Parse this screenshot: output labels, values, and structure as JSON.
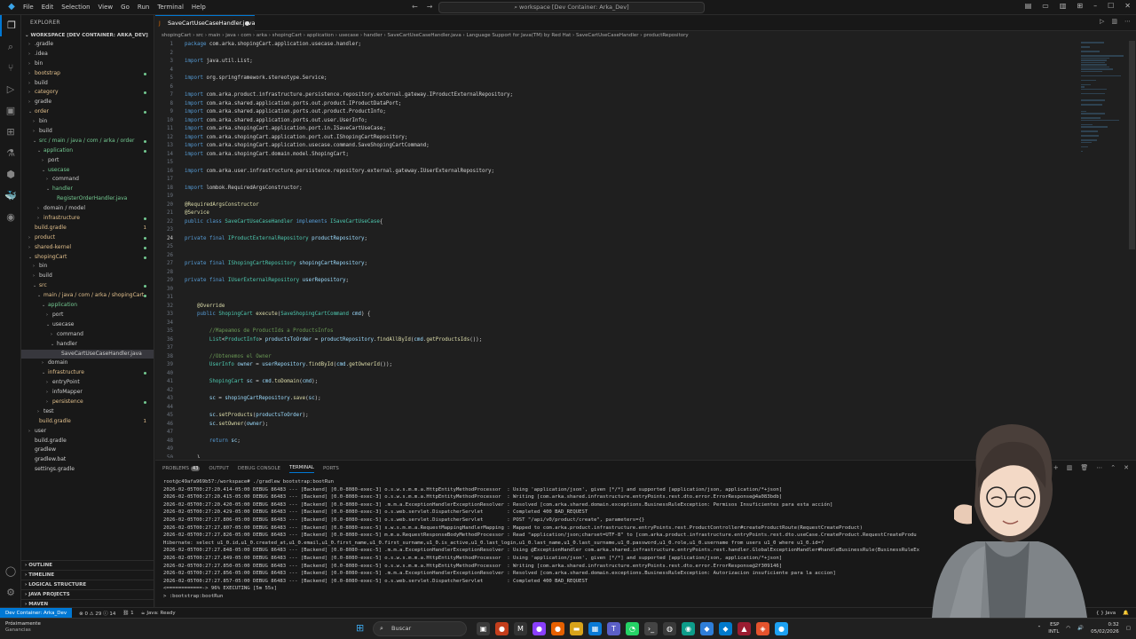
{
  "titlebar": {
    "menu": [
      "File",
      "Edit",
      "Selection",
      "View",
      "Go",
      "Run",
      "Terminal",
      "Help"
    ],
    "command_center": "workspace [Dev Container: Arka_Dev]"
  },
  "sidebar": {
    "header": "EXPLORER",
    "workspace": "WORKSPACE [DEV CONTAINER: ARKA_DEV]",
    "items": [
      {
        "label": ".gradle",
        "indent": 0,
        "chev": "›",
        "color": "white"
      },
      {
        "label": ".idea",
        "indent": 0,
        "chev": "›",
        "color": "white"
      },
      {
        "label": "bin",
        "indent": 0,
        "chev": "›",
        "color": "white"
      },
      {
        "label": "bootstrap",
        "indent": 0,
        "chev": "›",
        "color": "yellow",
        "dot": true
      },
      {
        "label": "build",
        "indent": 0,
        "chev": "›",
        "color": "white"
      },
      {
        "label": "category",
        "indent": 0,
        "chev": "›",
        "color": "yellow",
        "dot": true
      },
      {
        "label": "gradle",
        "indent": 0,
        "chev": "›",
        "color": "white"
      },
      {
        "label": "order",
        "indent": 0,
        "chev": "⌄",
        "color": "yellow",
        "dot": true
      },
      {
        "label": "bin",
        "indent": 1,
        "chev": "›",
        "color": "white"
      },
      {
        "label": "build",
        "indent": 1,
        "chev": "›",
        "color": "white"
      },
      {
        "label": "src / main / java / com / arka / order",
        "indent": 1,
        "chev": "⌄",
        "color": "green",
        "dot": true
      },
      {
        "label": "application",
        "indent": 2,
        "chev": "⌄",
        "color": "green",
        "dot": true
      },
      {
        "label": "port",
        "indent": 3,
        "chev": "›",
        "color": "white"
      },
      {
        "label": "usecase",
        "indent": 3,
        "chev": "⌄",
        "color": "green"
      },
      {
        "label": "command",
        "indent": 4,
        "chev": "›",
        "color": "white"
      },
      {
        "label": "handler",
        "indent": 4,
        "chev": "⌄",
        "color": "green"
      },
      {
        "label": "RegisterOrderHandler.java",
        "indent": 5,
        "chev": "",
        "color": "green"
      },
      {
        "label": "domain / model",
        "indent": 2,
        "chev": "›",
        "color": "white"
      },
      {
        "label": "infrastructure",
        "indent": 2,
        "chev": "›",
        "color": "yellow",
        "dot": true
      },
      {
        "label": "build.gradle",
        "indent": 0,
        "chev": "",
        "color": "yellow",
        "cnt": "1"
      },
      {
        "label": "product",
        "indent": 0,
        "chev": "›",
        "color": "yellow",
        "dot": true
      },
      {
        "label": "shared-kernel",
        "indent": 0,
        "chev": "›",
        "color": "yellow",
        "dot": true
      },
      {
        "label": "shopingCart",
        "indent": 0,
        "chev": "⌄",
        "color": "yellow",
        "dot": true
      },
      {
        "label": "bin",
        "indent": 1,
        "chev": "›",
        "color": "white"
      },
      {
        "label": "build",
        "indent": 1,
        "chev": "›",
        "color": "white"
      },
      {
        "label": "src",
        "indent": 1,
        "chev": "⌄",
        "color": "yellow",
        "dot": true
      },
      {
        "label": "main / java / com / arka / shopingCart",
        "indent": 2,
        "chev": "⌄",
        "color": "yellow",
        "dot": true
      },
      {
        "label": "application",
        "indent": 3,
        "chev": "⌄",
        "color": "green"
      },
      {
        "label": "port",
        "indent": 4,
        "chev": "›",
        "color": "white"
      },
      {
        "label": "usecase",
        "indent": 4,
        "chev": "⌄",
        "color": "white"
      },
      {
        "label": "command",
        "indent": 5,
        "chev": "›",
        "color": "white"
      },
      {
        "label": "handler",
        "indent": 5,
        "chev": "⌄",
        "color": "white"
      },
      {
        "label": "SaveCartUseCaseHandler.java",
        "indent": 6,
        "chev": "",
        "color": "white",
        "selected": true
      },
      {
        "label": "domain",
        "indent": 3,
        "chev": "›",
        "color": "white"
      },
      {
        "label": "infrastructure",
        "indent": 3,
        "chev": "⌄",
        "color": "yellow",
        "dot": true
      },
      {
        "label": "entryPoint",
        "indent": 4,
        "chev": "›",
        "color": "white"
      },
      {
        "label": "infoMapper",
        "indent": 4,
        "chev": "›",
        "color": "white"
      },
      {
        "label": "persistence",
        "indent": 4,
        "chev": "›",
        "color": "yellow",
        "dot": true
      },
      {
        "label": "test",
        "indent": 2,
        "chev": "›",
        "color": "white"
      },
      {
        "label": "build.gradle",
        "indent": 1,
        "chev": "",
        "color": "yellow",
        "cnt": "1"
      },
      {
        "label": "user",
        "indent": 0,
        "chev": "›",
        "color": "white"
      },
      {
        "label": "build.gradle",
        "indent": 0,
        "chev": "",
        "color": "white"
      },
      {
        "label": "gradlew",
        "indent": 0,
        "chev": "",
        "color": "white"
      },
      {
        "label": "gradlew.bat",
        "indent": 0,
        "chev": "",
        "color": "white"
      },
      {
        "label": "settings.gradle",
        "indent": 0,
        "chev": "",
        "color": "white"
      }
    ],
    "sections": [
      "OUTLINE",
      "TIMELINE",
      "LOGICAL STRUCTURE",
      "JAVA PROJECTS",
      "MAVEN"
    ]
  },
  "editor": {
    "tab_label": "SaveCartUseCaseHandler.java",
    "breadcrumb": "shopingCart › src › main › java › com › arka › shopingCart › application › usecase › handler › SaveCartUseCaseHandler.java › Language Support for Java(TM) by Red Hat › SaveCartUseCaseHandler › productRepository",
    "current_line": 24,
    "code_lines": [
      [
        [
          "kw",
          "package "
        ],
        [
          "pl",
          "com.arka.shopingCart.application.usecase.handler;"
        ]
      ],
      [],
      [
        [
          "kw",
          "import "
        ],
        [
          "pl",
          "java.util.List;"
        ]
      ],
      [],
      [
        [
          "kw",
          "import "
        ],
        [
          "pl",
          "org.springframework.stereotype.Service;"
        ]
      ],
      [],
      [
        [
          "kw",
          "import "
        ],
        [
          "pl",
          "com.arka.product.infrastructure.persistence.repository.external.gateway.IProductExternalRepository;"
        ]
      ],
      [
        [
          "kw",
          "import "
        ],
        [
          "pl",
          "com.arka.shared.application.ports.out.product.IProductDataPort;"
        ]
      ],
      [
        [
          "kw",
          "import "
        ],
        [
          "pl",
          "com.arka.shared.application.ports.out.product.ProductInfo;"
        ]
      ],
      [
        [
          "kw",
          "import "
        ],
        [
          "pl",
          "com.arka.shared.application.ports.out.user.UserInfo;"
        ]
      ],
      [
        [
          "kw",
          "import "
        ],
        [
          "pl",
          "com.arka.shopingCart.application.port.in.ISaveCartUseCase;"
        ]
      ],
      [
        [
          "kw",
          "import "
        ],
        [
          "pl",
          "com.arka.shopingCart.application.port.out.IShopingCartRepository;"
        ]
      ],
      [
        [
          "kw",
          "import "
        ],
        [
          "pl",
          "com.arka.shopingCart.application.usecase.command.SaveShopingCartCommand;"
        ]
      ],
      [
        [
          "kw",
          "import "
        ],
        [
          "pl",
          "com.arka.shopingCart.domain.model.ShopingCart;"
        ]
      ],
      [],
      [
        [
          "kw",
          "import "
        ],
        [
          "pl",
          "com.arka.user.infrastructure.persistence.repository.external.gateway.IUserExternalRepository;"
        ]
      ],
      [],
      [
        [
          "kw",
          "import "
        ],
        [
          "pl",
          "lombok.RequiredArgsConstructor;"
        ]
      ],
      [],
      [
        [
          "an",
          "@RequiredArgsConstructor"
        ]
      ],
      [
        [
          "an",
          "@Service"
        ]
      ],
      [
        [
          "kw",
          "public class "
        ],
        [
          "ty",
          "SaveCartUseCaseHandler "
        ],
        [
          "kw",
          "implements "
        ],
        [
          "ty",
          "ISaveCartUseCase"
        ],
        [
          "pl",
          "{"
        ]
      ],
      [],
      [
        [
          "kw",
          "private final "
        ],
        [
          "ty",
          "IProductExternalRepository "
        ],
        [
          "va",
          "productRepository"
        ],
        [
          "pl",
          ";"
        ]
      ],
      [],
      [],
      [
        [
          "kw",
          "private final "
        ],
        [
          "ty",
          "IShopingCartRepository "
        ],
        [
          "va",
          "shopingCartRepository"
        ],
        [
          "pl",
          ";"
        ]
      ],
      [],
      [
        [
          "kw",
          "private final "
        ],
        [
          "ty",
          "IUserExternalRepository "
        ],
        [
          "va",
          "userRepository"
        ],
        [
          "pl",
          ";"
        ]
      ],
      [],
      [],
      [
        [
          "pl",
          "    "
        ],
        [
          "an",
          "@Override"
        ]
      ],
      [
        [
          "pl",
          "    "
        ],
        [
          "kw",
          "public "
        ],
        [
          "ty",
          "ShopingCart "
        ],
        [
          "fn",
          "execute"
        ],
        [
          "pl",
          "("
        ],
        [
          "ty",
          "SaveShopingCartCommand "
        ],
        [
          "va",
          "cmd"
        ],
        [
          "pl",
          ") {"
        ]
      ],
      [],
      [
        [
          "pl",
          "        "
        ],
        [
          "cm",
          "//Mapeamos de ProductIds a ProductsInfos"
        ]
      ],
      [
        [
          "pl",
          "        "
        ],
        [
          "ty",
          "List"
        ],
        [
          "pl",
          "<"
        ],
        [
          "ty",
          "ProductInfo"
        ],
        [
          "pl",
          "> "
        ],
        [
          "va",
          "productsToOrder"
        ],
        [
          "pl",
          " = "
        ],
        [
          "va",
          "productRepository"
        ],
        [
          "pl",
          "."
        ],
        [
          "fn",
          "findAllById"
        ],
        [
          "pl",
          "("
        ],
        [
          "va",
          "cmd"
        ],
        [
          "pl",
          "."
        ],
        [
          "fn",
          "getProductsIds"
        ],
        [
          "pl",
          "());"
        ]
      ],
      [],
      [
        [
          "pl",
          "        "
        ],
        [
          "cm",
          "//Obtenemos el Owner"
        ]
      ],
      [
        [
          "pl",
          "        "
        ],
        [
          "ty",
          "UserInfo "
        ],
        [
          "va",
          "owner"
        ],
        [
          "pl",
          " = "
        ],
        [
          "va",
          "userRepository"
        ],
        [
          "pl",
          "."
        ],
        [
          "fn",
          "findById"
        ],
        [
          "pl",
          "("
        ],
        [
          "va",
          "cmd"
        ],
        [
          "pl",
          "."
        ],
        [
          "fn",
          "getOwnerId"
        ],
        [
          "pl",
          "());"
        ]
      ],
      [],
      [
        [
          "pl",
          "        "
        ],
        [
          "ty",
          "ShopingCart "
        ],
        [
          "va",
          "sc"
        ],
        [
          "pl",
          " = "
        ],
        [
          "va",
          "cmd"
        ],
        [
          "pl",
          "."
        ],
        [
          "fn",
          "toDomain"
        ],
        [
          "pl",
          "("
        ],
        [
          "va",
          "cmd"
        ],
        [
          "pl",
          ");"
        ]
      ],
      [],
      [
        [
          "pl",
          "        "
        ],
        [
          "va",
          "sc"
        ],
        [
          "pl",
          " = "
        ],
        [
          "va",
          "shopingCartRepository"
        ],
        [
          "pl",
          "."
        ],
        [
          "fn",
          "save"
        ],
        [
          "pl",
          "("
        ],
        [
          "va",
          "sc"
        ],
        [
          "pl",
          ");"
        ]
      ],
      [],
      [
        [
          "pl",
          "        "
        ],
        [
          "va",
          "sc"
        ],
        [
          "pl",
          "."
        ],
        [
          "fn",
          "setProducts"
        ],
        [
          "pl",
          "("
        ],
        [
          "va",
          "productsToOrder"
        ],
        [
          "pl",
          ");"
        ]
      ],
      [
        [
          "pl",
          "        "
        ],
        [
          "va",
          "sc"
        ],
        [
          "pl",
          "."
        ],
        [
          "fn",
          "setOwner"
        ],
        [
          "pl",
          "("
        ],
        [
          "va",
          "owner"
        ],
        [
          "pl",
          ");"
        ]
      ],
      [],
      [
        [
          "pl",
          "        "
        ],
        [
          "kw",
          "return "
        ],
        [
          "va",
          "sc"
        ],
        [
          "pl",
          ";"
        ]
      ],
      [],
      [
        [
          "pl",
          "    }"
        ]
      ]
    ]
  },
  "panel": {
    "tabs": [
      "PROBLEMS",
      "OUTPUT",
      "DEBUG CONSOLE",
      "TERMINAL",
      "PORTS"
    ],
    "problems_count": "43",
    "active_tab": "TERMINAL",
    "terminal_lines": [
      "root@c49afa969b57:/workspace# ./gradlew bootstrap:bootRun",
      "2026-02-05T00:27:20.414-05:00 DEBUG 86483 --- [Backend] [0.0-8080-exec-3] o.s.w.s.m.m.a.HttpEntityMethodProcessor  : Using 'application/json', given [*/*] and supported [application/json, application/*+json]",
      "2026-02-05T00:27:20.415-05:00 DEBUG 86483 --- [Backend] [0.0-8080-exec-3] o.s.w.s.m.m.a.HttpEntityMethodProcessor  : Writing [com.arka.shared.infrastructure.entryPoints.rest.dto.error.ErrorResponse@4a083bdb]",
      "2026-02-05T00:27:20.420-05:00 DEBUG 86483 --- [Backend] [0.0-8080-exec-3] .m.m.a.ExceptionHandlerExceptionResolver : Resolved [com.arka.shared.domain.exceptions.BusinessRuleException: Permisos Insuficientes para esta acción]",
      "2026-02-05T00:27:20.429-05:00 DEBUG 86483 --- [Backend] [0.0-8080-exec-3] o.s.web.servlet.DispatcherServlet        : Completed 400 BAD_REQUEST",
      "2026-02-05T00:27:27.806-05:00 DEBUG 86483 --- [Backend] [0.0-8080-exec-5] o.s.web.servlet.DispatcherServlet        : POST \"/api/v0/product/create\", parameters={}",
      "2026-02-05T00:27:27.807-05:00 DEBUG 86483 --- [Backend] [0.0-8080-exec-5] s.w.s.m.m.a.RequestMappingHandlerMapping : Mapped to com.arka.product.infrastructure.entryPoints.rest.ProductController#createProductRoute(RequestCreateProduct)",
      "2026-02-05T00:27:27.826-05:00 DEBUG 86483 --- [Backend] [0.0-8080-exec-5] m.m.a.RequestResponseBodyMethodProcessor : Read \"application/json;charset=UTF-8\" to [com.arka.product.infrastructure.entryPoints.rest.dto.useCase.CreateProduct.RequestCreateProdu",
      "Hibernate: select u1_0.id,u1_0.created_at,u1_0.email,u1_0.first_name,u1_0.first_surname,u1_0.is_active,u1_0.last_login,u1_0.last_name,u1_0.last_surname,u1_0.password,u1_0.role,u1_0.username from users u1_0 where u1_0.id=?",
      "2026-02-05T00:27:27.848-05:00 DEBUG 86483 --- [Backend] [0.0-8080-exec-5] .m.m.a.ExceptionHandlerExceptionResolver : Using @ExceptionHandler com.arka.shared.infrastructure.entryPoints.rest.handler.GlobalExceptionHandler#handleBusinessRule(BusinessRuleEx",
      "2026-02-05T00:27:27.849-05:00 DEBUG 86483 --- [Backend] [0.0-8080-exec-5] o.s.w.s.m.m.a.HttpEntityMethodProcessor  : Using 'application/json', given [*/*] and supported [application/json, application/*+json]",
      "2026-02-05T00:27:27.850-05:00 DEBUG 86483 --- [Backend] [0.0-8080-exec-5] o.s.w.s.m.m.a.HttpEntityMethodProcessor  : Writing [com.arka.shared.infrastructure.entryPoints.rest.dto.error.ErrorResponse@2f309146]",
      "2026-02-05T00:27:27.856-05:00 DEBUG 86483 --- [Backend] [0.0-8080-exec-5] .m.m.a.ExceptionHandlerExceptionResolver : Resolved [com.arka.shared.domain.exceptions.BusinessRuleException: Autorizacion insuficiente para la accion]",
      "2026-02-05T00:27:27.857-05:00 DEBUG 86483 --- [Backend] [0.0-8080-exec-5] o.s.web.servlet.DispatcherServlet        : Completed 400 BAD_REQUEST",
      "<============-> 96% EXECUTING [5m 55s]",
      "> :bootstrap:bootRun"
    ]
  },
  "statusbar": {
    "remote": "Dev Container: Arka_Dev",
    "problems": "⊗ 0 ⚠ 29 ⓘ 14",
    "ports": "⛓ 1",
    "java": "☕ Java: Ready",
    "right_lang": "{ } Java"
  },
  "taskbar": {
    "weather_title": "Próximamente",
    "weather_sub": "Ganancias",
    "search_label": "Buscar",
    "lang_top": "ESP",
    "lang_bottom": "INTL",
    "time": "0:32",
    "date": "05/02/2026"
  }
}
